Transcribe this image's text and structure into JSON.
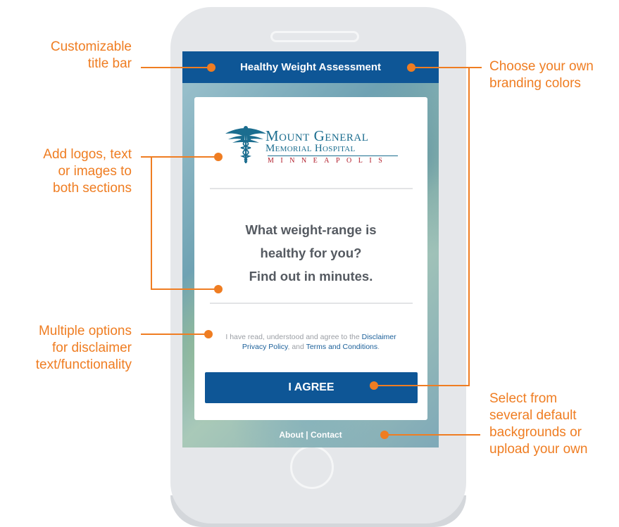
{
  "app": {
    "title_bar": "Healthy Weight Assessment",
    "logo": {
      "line1": "Mount General",
      "line2": "Memorial Hospital",
      "line3": "MINNEAPOLIS"
    },
    "headline": [
      "What weight-range is",
      "healthy for you?",
      "Find out in minutes."
    ],
    "disclaimer": {
      "prefix": "I have read, understood and agree to the ",
      "link1": "Disclaimer",
      "link2": "Privacy Policy",
      "joiner": ", and ",
      "link3": "Terms and Conditions",
      "suffix": "."
    },
    "agree_button": "I AGREE",
    "footer": {
      "about": "About",
      "separator": " | ",
      "contact": "Contact"
    }
  },
  "annotations": {
    "title_bar": [
      "Customizable",
      "title bar"
    ],
    "logos": [
      "Add logos, text",
      "or images to",
      "both sections"
    ],
    "disclaimer": [
      "Multiple options",
      "for disclaimer",
      "text/functionality"
    ],
    "branding": [
      "Choose your own",
      "branding colors"
    ],
    "backgrounds": [
      "Select from",
      "several default",
      "backgrounds or",
      "upload your own"
    ]
  },
  "colors": {
    "accent_orange": "#ef7d22",
    "brand_blue": "#0e5696",
    "phone_gray": "#e5e7ea"
  },
  "icons": [
    "caduceus-icon",
    "speaker-slot-icon",
    "home-button-icon"
  ]
}
